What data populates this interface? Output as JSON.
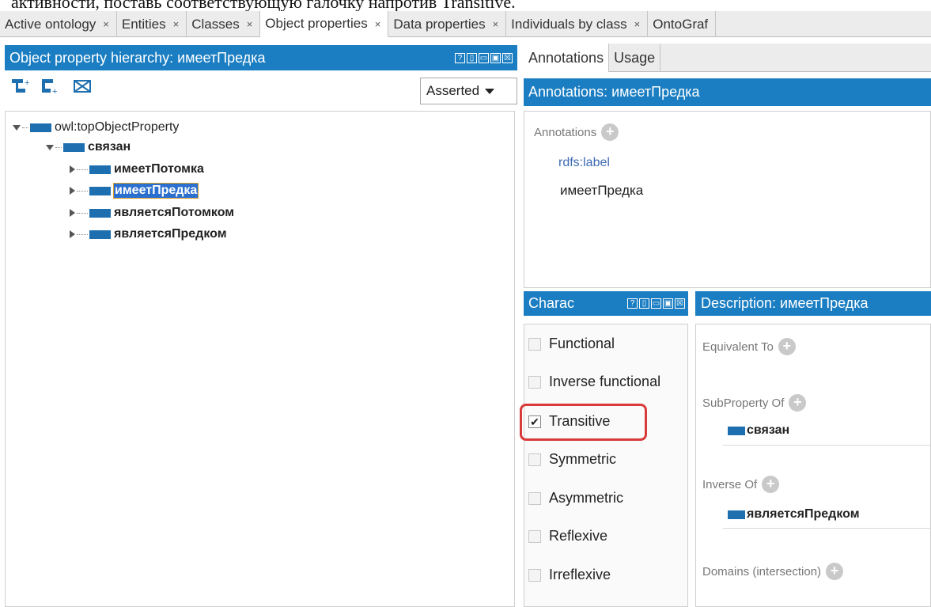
{
  "doc_text": "активности, поставь соответствующую галочку напротив Transitive.",
  "tabs": [
    {
      "label": "Active ontology",
      "active": false
    },
    {
      "label": "Entities",
      "active": false
    },
    {
      "label": "Classes",
      "active": false
    },
    {
      "label": "Object properties",
      "active": true
    },
    {
      "label": "Data properties",
      "active": false
    },
    {
      "label": "Individuals by class",
      "active": false
    },
    {
      "label": "OntoGraf",
      "active": false
    }
  ],
  "close_glyph": "×",
  "hierarchy": {
    "title": "Object property hierarchy: имеетПредка",
    "mode": "Asserted",
    "tree": [
      {
        "label": "owl:topObjectProperty"
      },
      {
        "label": "связан"
      },
      {
        "label": "имеетПотомка"
      },
      {
        "label": "имеетПредка"
      },
      {
        "label": "являетсяПотомком"
      },
      {
        "label": "являетсяПредком"
      }
    ]
  },
  "view_controls": [
    "?",
    "▯",
    "▭",
    "▣",
    "☒"
  ],
  "right": {
    "subtabs": [
      "Annotations",
      "Usage"
    ],
    "annotations_title": "Annotations: имеетПредка",
    "annotations_label": "Annotations",
    "annotation_property": "rdfs:label",
    "annotation_value": "имеетПредка",
    "characteristics_title": "Charac",
    "characteristics": [
      {
        "label": "Functional",
        "checked": false
      },
      {
        "label": "Inverse functional",
        "checked": false
      },
      {
        "label": "Transitive",
        "checked": true
      },
      {
        "label": "Symmetric",
        "checked": false
      },
      {
        "label": "Asymmetric",
        "checked": false
      },
      {
        "label": "Reflexive",
        "checked": false
      },
      {
        "label": "Irreflexive",
        "checked": false
      }
    ],
    "description_title": "Description: имеетПредка",
    "equivalent_to": "Equivalent To",
    "subproperty_of": "SubProperty Of",
    "subproperty_value": "связан",
    "inverse_of": "Inverse Of",
    "inverse_value": "являетсяПредком",
    "domains": "Domains (intersection)"
  },
  "check_glyph": "✔",
  "plus_glyph": "+",
  "accent_color": "#1b7ec2",
  "highlight_color": "#d93a3a"
}
